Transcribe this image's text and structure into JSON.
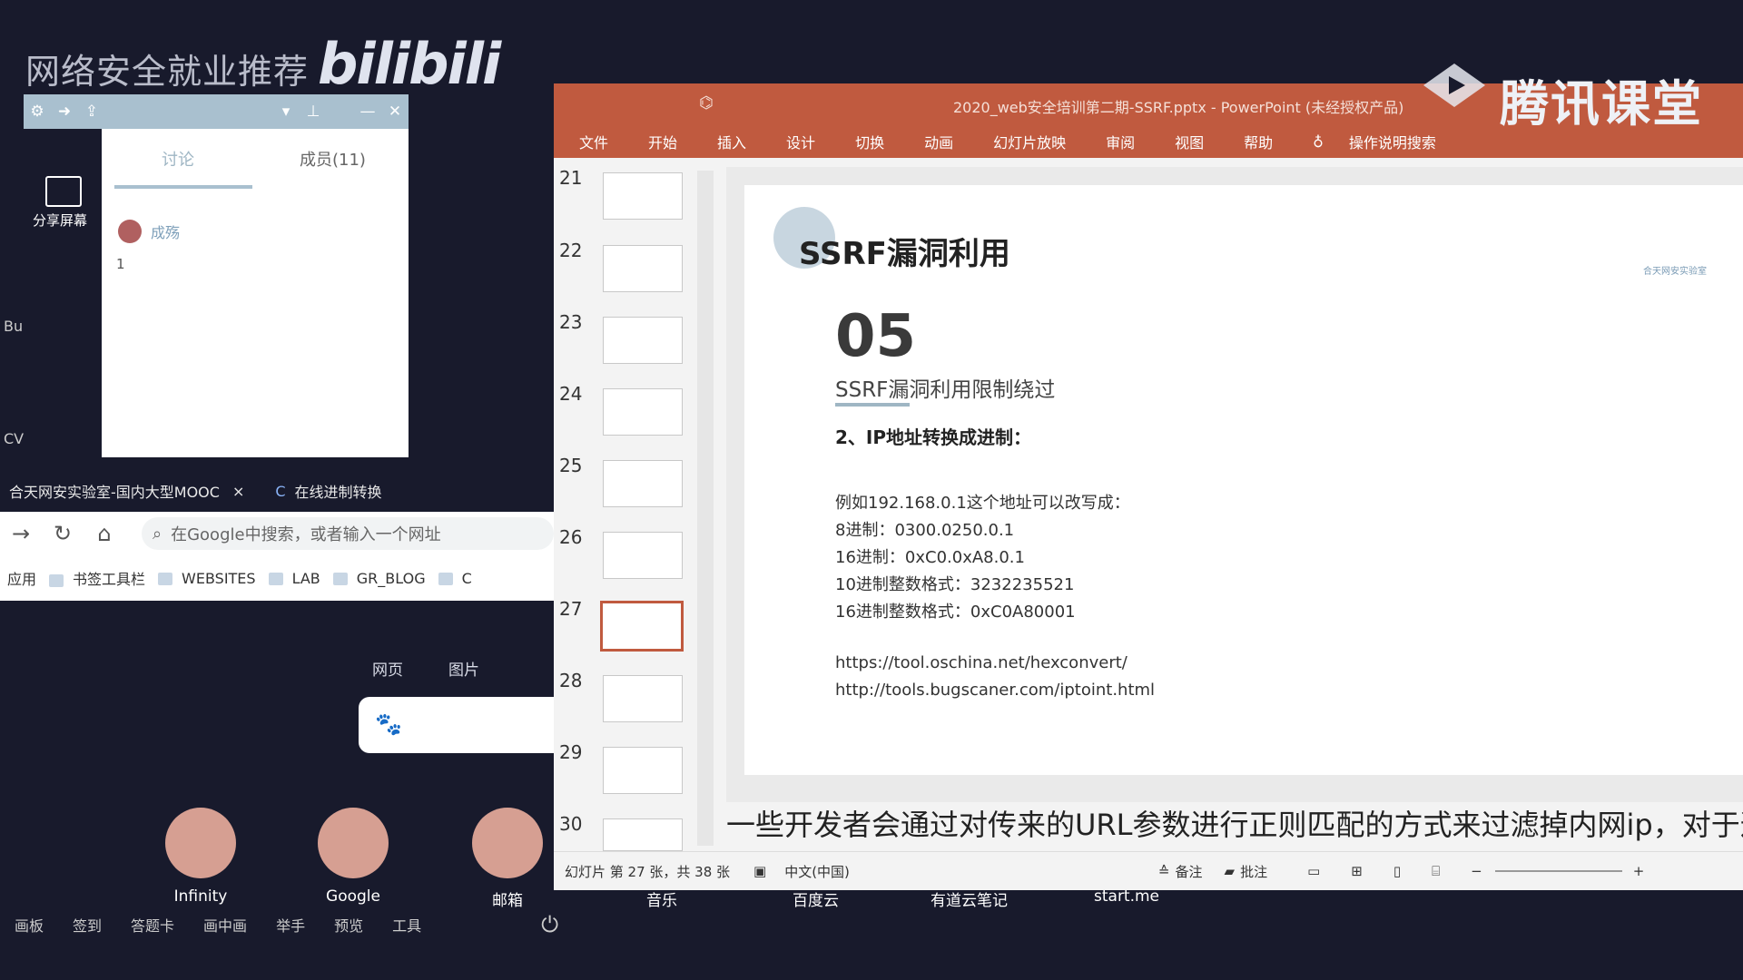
{
  "watermark": {
    "left_text": "网络安全就业推荐",
    "bili": "bilibili",
    "tencent": "腾讯课堂"
  },
  "chat": {
    "tab_discuss": "讨论",
    "tab_members": "成员(11)",
    "user_name": "成殇",
    "message": "1",
    "share_label": "分享屏幕",
    "side_labels": [
      "Bu",
      "CV"
    ]
  },
  "browser": {
    "tabs": [
      {
        "label": "合天网安实验室-国内大型MOOC",
        "close": "×"
      },
      {
        "label": "在线进制转换"
      }
    ],
    "omnibox_placeholder": "在Google中搜索，或者输入一个网址",
    "bookmarks": [
      "应用",
      "书签工具栏",
      "WEBSITES",
      "LAB",
      "GR_BLOG",
      "C"
    ],
    "newtab_links": [
      "网页",
      "图片"
    ],
    "shortcuts": [
      {
        "label": "Infinity",
        "color": "#d69f92"
      },
      {
        "label": "Google",
        "color": "#d69f92"
      },
      {
        "label": "邮箱",
        "color": "#d69f92"
      }
    ],
    "bottom_labels": [
      "音乐",
      "百度云",
      "有道云笔记",
      "start.me"
    ]
  },
  "toolbar": [
    "画板",
    "签到",
    "答题卡",
    "画中画",
    "举手",
    "预览",
    "工具"
  ],
  "ppt": {
    "title": "2020_web安全培训第二期-SSRF.pptx  -  PowerPoint (未经授权产品)",
    "menu": [
      "文件",
      "开始",
      "插入",
      "设计",
      "切换",
      "动画",
      "幻灯片放映",
      "审阅",
      "视图",
      "帮助",
      "操作说明搜索"
    ],
    "thumbnails": [
      "21",
      "22",
      "23",
      "24",
      "25",
      "26",
      "27",
      "28",
      "29",
      "30"
    ],
    "active_thumbnail": "27",
    "slide": {
      "title": "SSRF漏洞利用",
      "number": "05",
      "subtitle": "SSRF漏洞利用限制绕过",
      "heading": "2、IP地址转换成进制：",
      "lines": [
        "例如192.168.0.1这个地址可以改写成：",
        "8进制：0300.0250.0.1",
        "16进制：0xC0.0xA8.0.1",
        "10进制整数格式：3232235521",
        "16进制整数格式：0xC0A80001"
      ],
      "links": [
        "https://tool.oschina.net/hexconvert/",
        "http://tools.bugscaner.com/iptoint.html"
      ],
      "logo_text": "合天网安实验室"
    },
    "subtitle_caption": "一些开发者会通过对传来的URL参数进行正则匹配的方式来过滤掉内网ip，对于这",
    "status": {
      "slide_info": "幻灯片 第 27 张，共 38 张",
      "language": "中文(中国)",
      "notes": "备注",
      "comments": "批注"
    },
    "accent": "#c05a3f"
  }
}
